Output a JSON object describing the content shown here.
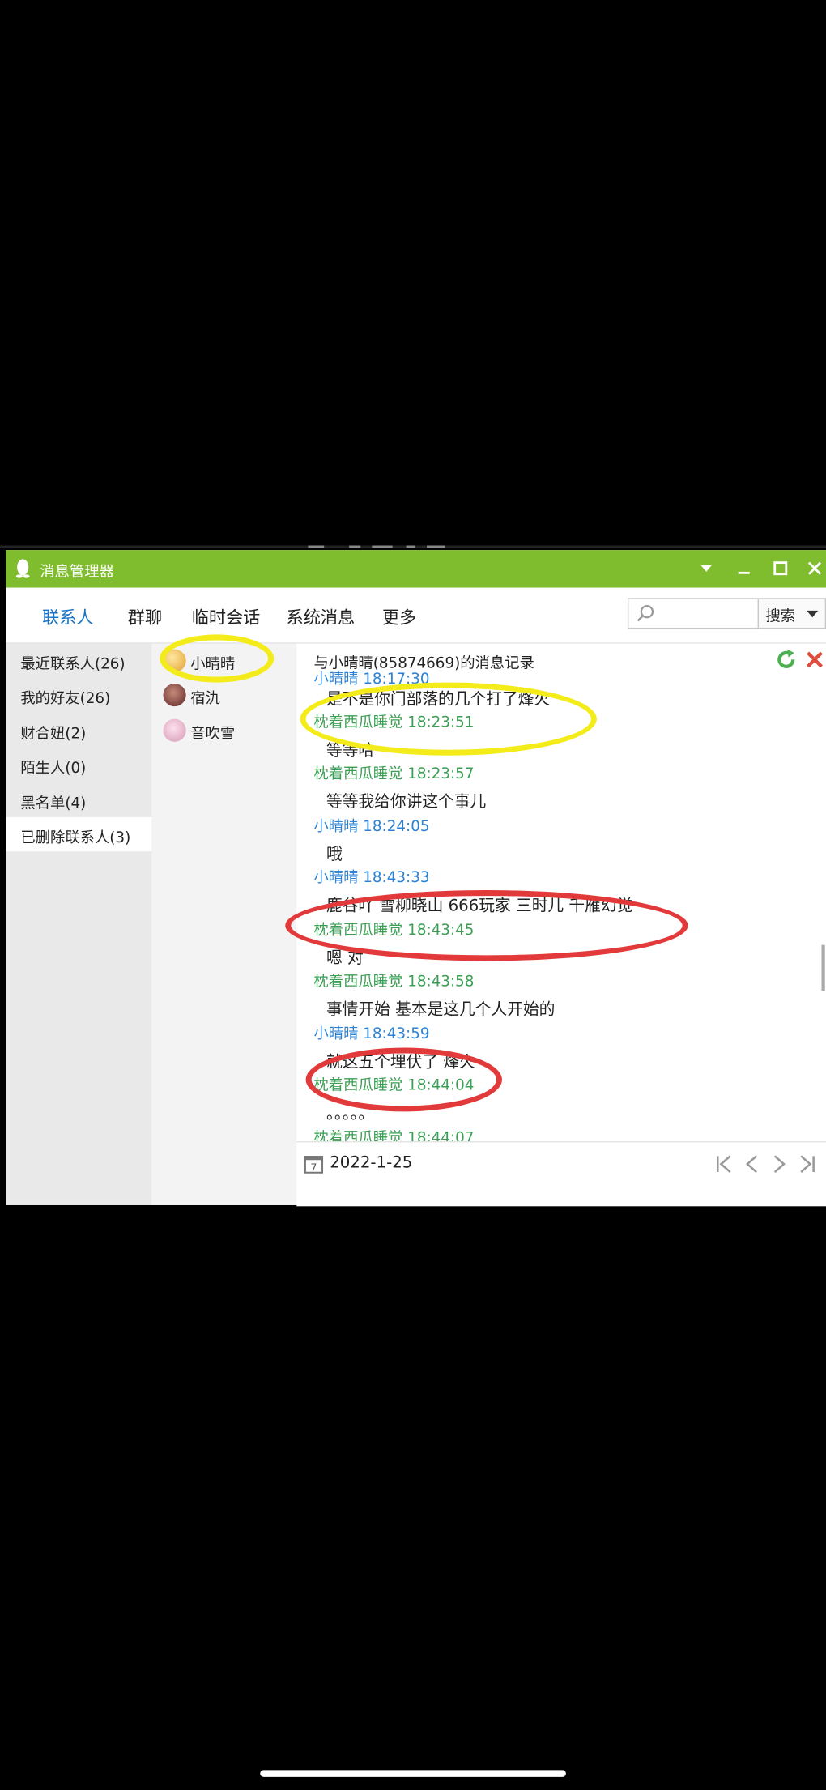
{
  "window": {
    "title": "消息管理器"
  },
  "tabs": [
    "联系人",
    "群聊",
    "临时会话",
    "系统消息",
    "更多"
  ],
  "search": {
    "placeholder": "",
    "button_label": "搜索"
  },
  "categories": [
    "最近联系人(26)",
    "我的好友(26)",
    "财合妞(2)",
    "陌生人(0)",
    "黑名单(4)",
    "已删除联系人(3)"
  ],
  "contacts": [
    "小晴晴",
    "宿氿",
    "音吹雪"
  ],
  "chat": {
    "header": "与小晴晴(85874669)的消息记录",
    "messages": [
      {
        "sender": "小晴晴 18:17:30",
        "text": "是不是你门部落的几个打了烽火"
      },
      {
        "sender": "枕着西瓜睡觉 18:23:51",
        "text": "等等哈"
      },
      {
        "sender": "枕着西瓜睡觉 18:23:57",
        "text": "等等我给你讲这个事儿"
      },
      {
        "sender": "小晴晴 18:24:05",
        "text": "哦"
      },
      {
        "sender": "小晴晴 18:43:33",
        "text": "鹿谷吖 雪柳晓山 666玩家 三时儿   千雁幻觉"
      },
      {
        "sender": "枕着西瓜睡觉 18:43:45",
        "text": "嗯 对"
      },
      {
        "sender": "枕着西瓜睡觉 18:43:58",
        "text": "事情开始 基本是这几个人开始的"
      },
      {
        "sender": "小晴晴 18:43:59",
        "text": "就这五个埋伏了 烽火"
      },
      {
        "sender": "枕着西瓜睡觉 18:44:04",
        "text": "。。。。。"
      },
      {
        "sender": "枕着西瓜睡觉 18:44:07",
        "text": ""
      }
    ],
    "date": "2022-1-25"
  },
  "colors": {
    "titlebar": "#7fbd2f",
    "active_tab": "#1b74c3",
    "self_name": "#2c83d6",
    "other_name": "#3a9e53",
    "highlight_yellow": "#f4ec1a",
    "highlight_red": "#e23a3a"
  },
  "icons": [
    "qq-penguin-icon",
    "dropdown-icon",
    "minimize-icon",
    "maximize-icon",
    "close-icon",
    "search-icon",
    "refresh-icon",
    "delete-icon",
    "calendar-icon",
    "first-page-icon",
    "prev-page-icon",
    "next-page-icon",
    "last-page-icon"
  ]
}
